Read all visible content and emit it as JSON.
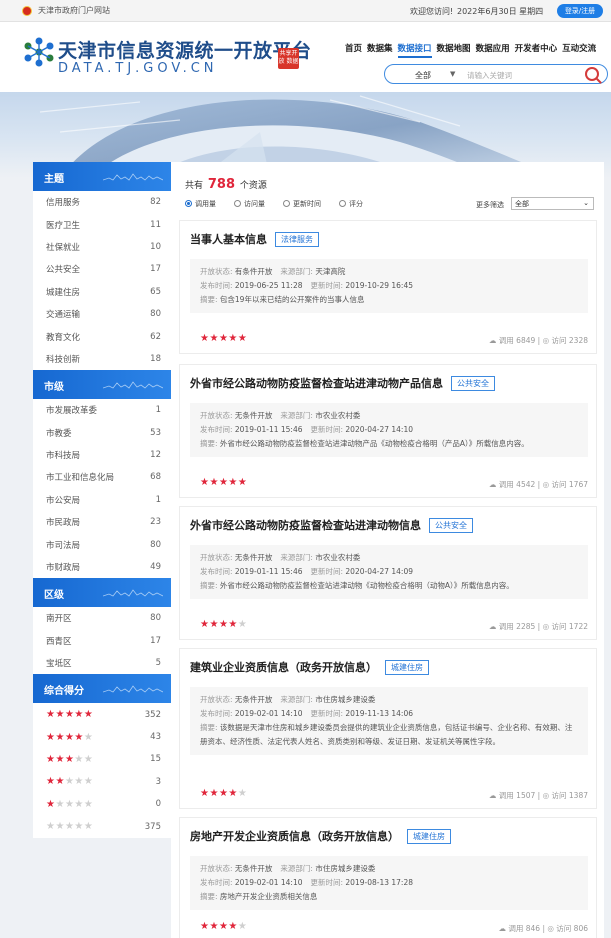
{
  "topbar": {
    "gov_link": "天津市政府门户网站",
    "welcome": "欢迎您访问!",
    "date": "2022年6月30日 星期四",
    "login": "登录/注册"
  },
  "header": {
    "site_title": "天津市信息资源统一开放平台",
    "site_url": "DATA.TJ.GOV.CN",
    "seal_text": "共享开放 数据",
    "nav": [
      "首页",
      "数据集",
      "数据接口",
      "数据地图",
      "数据应用",
      "开发者中心",
      "互动交流"
    ],
    "nav_active_index": 2,
    "search_category": "全部",
    "search_placeholder": "请输入关键词"
  },
  "sidebar": {
    "topic": {
      "title": "主题",
      "items": [
        {
          "label": "信用服务",
          "count": "82"
        },
        {
          "label": "医疗卫生",
          "count": "11"
        },
        {
          "label": "社保就业",
          "count": "10"
        },
        {
          "label": "公共安全",
          "count": "17"
        },
        {
          "label": "城建住房",
          "count": "65"
        },
        {
          "label": "交通运输",
          "count": "80"
        },
        {
          "label": "教育文化",
          "count": "62"
        },
        {
          "label": "科技创新",
          "count": "18"
        }
      ]
    },
    "city": {
      "title": "市级",
      "items": [
        {
          "label": "市发展改革委",
          "count": "1"
        },
        {
          "label": "市教委",
          "count": "53"
        },
        {
          "label": "市科技局",
          "count": "12"
        },
        {
          "label": "市工业和信息化局",
          "count": "68"
        },
        {
          "label": "市公安局",
          "count": "1"
        },
        {
          "label": "市民政局",
          "count": "23"
        },
        {
          "label": "市司法局",
          "count": "80"
        },
        {
          "label": "市财政局",
          "count": "49"
        }
      ]
    },
    "district": {
      "title": "区级",
      "items": [
        {
          "label": "南开区",
          "count": "80"
        },
        {
          "label": "西青区",
          "count": "17"
        },
        {
          "label": "宝坻区",
          "count": "5"
        }
      ]
    },
    "score": {
      "title": "综合得分",
      "items": [
        {
          "stars": 5,
          "count": "352"
        },
        {
          "stars": 4,
          "count": "43"
        },
        {
          "stars": 3,
          "count": "15"
        },
        {
          "stars": 2,
          "count": "3"
        },
        {
          "stars": 1,
          "count": "0"
        },
        {
          "stars": 0,
          "count": "375"
        }
      ]
    }
  },
  "main": {
    "count_prefix": "共有",
    "count_value": "788",
    "count_suffix": "个资源",
    "sorts": [
      "调用量",
      "访问量",
      "更新时间",
      "评分"
    ],
    "sort_selected": 0,
    "filter_label": "更多筛选",
    "filter_value": "全部",
    "cards": [
      {
        "title": "当事人基本信息",
        "tag": "法律服务",
        "status_label": "开放状态:",
        "status": "有条件开放",
        "dept_label": "来源部门:",
        "dept": "天津高院",
        "pub_label": "发布时间:",
        "pub": "2019-06-25 11:28",
        "upd_label": "更新时间:",
        "upd": "2019-10-29 16:45",
        "desc_label": "摘要:",
        "desc": "包含19年以来已结的公开案件的当事人信息",
        "rating": 5,
        "calls": "调用 6849",
        "visits": "访问 2328"
      },
      {
        "title": "外省市经公路动物防疫监督检查站进津动物产品信息",
        "tag": "公共安全",
        "status_label": "开放状态:",
        "status": "无条件开放",
        "dept_label": "来源部门:",
        "dept": "市农业农村委",
        "pub_label": "发布时间:",
        "pub": "2019-01-11 15:46",
        "upd_label": "更新时间:",
        "upd": "2020-04-27 14:10",
        "desc_label": "摘要:",
        "desc": "外省市经公路动物防疫监督检查站进津动物产品《动物检疫合格明（产品A）》所载信息内容。",
        "rating": 5,
        "calls": "调用 4542",
        "visits": "访问 1767"
      },
      {
        "title": "外省市经公路动物防疫监督检查站进津动物信息",
        "tag": "公共安全",
        "status_label": "开放状态:",
        "status": "无条件开放",
        "dept_label": "来源部门:",
        "dept": "市农业农村委",
        "pub_label": "发布时间:",
        "pub": "2019-01-11 15:46",
        "upd_label": "更新时间:",
        "upd": "2020-04-27 14:09",
        "desc_label": "摘要:",
        "desc": "外省市经公路动物防疫监督检查站进津动物《动物检疫合格明（动物A）》所载信息内容。",
        "rating": 4,
        "calls": "调用 2285",
        "visits": "访问 1722"
      },
      {
        "title": "建筑业企业资质信息（政务开放信息）",
        "tag": "城建住房",
        "status_label": "开放状态:",
        "status": "无条件开放",
        "dept_label": "来源部门:",
        "dept": "市住房城乡建设委",
        "pub_label": "发布时间:",
        "pub": "2019-02-01 14:10",
        "upd_label": "更新时间:",
        "upd": "2019-11-13 14:06",
        "desc_label": "摘要:",
        "desc": "该数据是天津市住房和城乡建设委员会提供的建筑业企业资质信息，包括证书编号、企业名称、有效期、注册资本、经济性质、法定代表人姓名、资质类别和等级、发证日期、发证机关等属性字段。",
        "rating": 4,
        "calls": "调用 1507",
        "visits": "访问 1387"
      },
      {
        "title": "房地产开发企业资质信息（政务开放信息）",
        "tag": "城建住房",
        "status_label": "开放状态:",
        "status": "无条件开放",
        "dept_label": "来源部门:",
        "dept": "市住房城乡建设委",
        "pub_label": "发布时间:",
        "pub": "2019-02-01 14:10",
        "upd_label": "更新时间:",
        "upd": "2019-08-13 17:28",
        "desc_label": "摘要:",
        "desc": "房地产开发企业资质相关信息",
        "rating": 4,
        "calls": "调用 846",
        "visits": "访问 806"
      }
    ]
  }
}
